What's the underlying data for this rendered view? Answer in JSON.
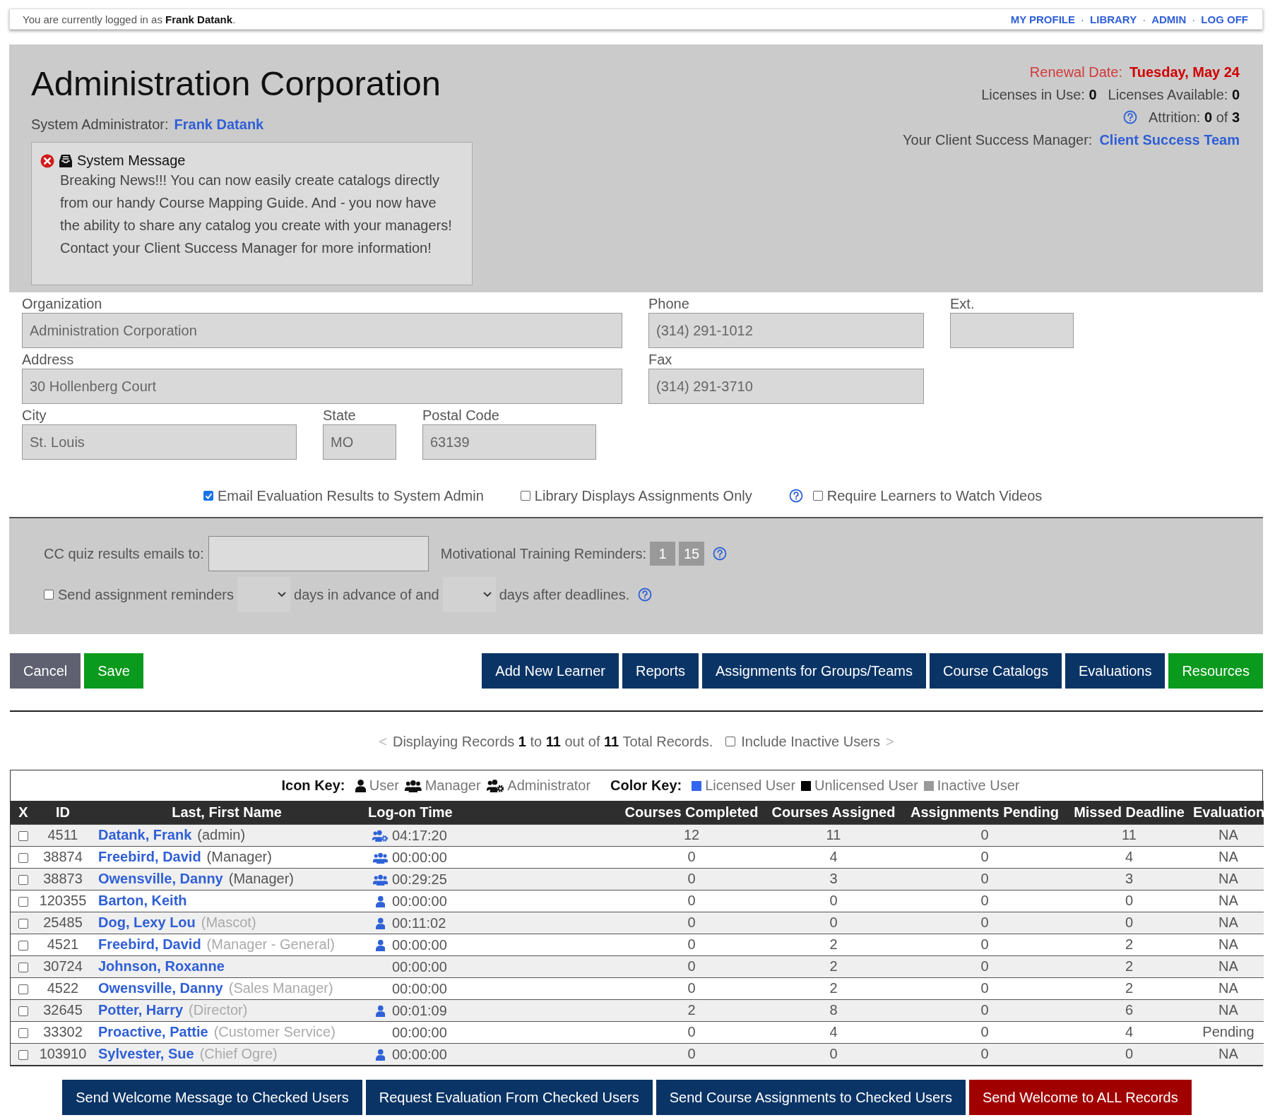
{
  "top_bar": {
    "login_text": "You are currently logged in as **Frank Datank**.",
    "separator": "·",
    "links": [
      "MY PROFILE",
      "LIBRARY",
      "ADMIN",
      "LOG OFF"
    ]
  },
  "header": {
    "title": "Administration Corporation",
    "admin_label": "System Administrator:",
    "admin_name": "Frank Datank",
    "message": {
      "title": "System Message",
      "body": "Breaking News!!! You can now easily create catalogs directly from our handy Course Mapping Guide. And - you now have the ability to share any catalog you create with your managers! Contact your Client Success Manager for more information!"
    },
    "renewal_label": "Renewal Date:",
    "renewal_date": "Tuesday, May 24",
    "licenses_in_use": "Licenses in Use: **0**",
    "licenses_available": "Licenses Available: **0**",
    "attrition": "Attrition: **0** of **3**",
    "csm_label": "Your Client Success Manager:",
    "csm_link": "Client Success Team"
  },
  "form": {
    "organization": {
      "label": "Organization",
      "value": "Administration Corporation"
    },
    "phone": {
      "label": "Phone",
      "value": "(314) 291-1012"
    },
    "ext": {
      "label": "Ext."
    },
    "address": {
      "label": "Address",
      "value": "30 Hollenberg Court"
    },
    "fax": {
      "label": "Fax",
      "value": "(314) 291-3710"
    },
    "city": {
      "label": "City",
      "value": "St. Louis"
    },
    "state": {
      "label": "State",
      "value": "MO"
    },
    "postal_code": {
      "label": "Postal Code",
      "value": "63139"
    }
  },
  "options": [
    {
      "label": "Email Evaluation Results to System Admin",
      "checked": true,
      "help": false
    },
    {
      "label": "Library Displays Assignments Only",
      "checked": false,
      "help": false
    },
    {
      "label": "Require Learners to Watch Videos",
      "checked": false,
      "help": true
    }
  ],
  "settings": {
    "cc_label": "CC quiz results emails to:",
    "reminders_label": "Motivational Training Reminders:",
    "reminder_values": [
      "1",
      "15"
    ],
    "send_reminders": {
      "label": "Send assignment reminders",
      "checked": false
    },
    "advance_label": "days in advance of and",
    "after_label": "days after deadlines."
  },
  "actions": {
    "left": [
      {
        "label": "Cancel",
        "kind": "neutral"
      },
      {
        "label": "Save",
        "kind": "success"
      }
    ],
    "right": [
      {
        "label": "Add New Learner",
        "kind": "primary"
      },
      {
        "label": "Reports",
        "kind": "primary"
      },
      {
        "label": "Assignments for Groups/Teams",
        "kind": "primary"
      },
      {
        "label": "Course Catalogs",
        "kind": "primary"
      },
      {
        "label": "Evaluations",
        "kind": "primary"
      },
      {
        "label": "Resources",
        "kind": "success"
      }
    ]
  },
  "summary": {
    "prev": "<",
    "text": "Displaying Records **1** to **11** out of **11** Total Records.",
    "include_inactive": {
      "label": "Include Inactive Users",
      "checked": false
    },
    "next": ">"
  },
  "icon_key": {
    "label": "Icon Key:",
    "items": [
      {
        "label": "User",
        "kind": "user"
      },
      {
        "label": "Manager",
        "kind": "manager"
      },
      {
        "label": "Administrator",
        "kind": "administrator"
      }
    ]
  },
  "color_key": {
    "label": "Color Key:",
    "items": [
      {
        "label": "Licensed User",
        "color": "#3366ee"
      },
      {
        "label": "Unlicensed User",
        "color": "#000000"
      },
      {
        "label": "Inactive User",
        "color": "#999999"
      }
    ]
  },
  "table": {
    "columns": [
      "X",
      "ID",
      "Last, First Name",
      "Log-on Time",
      "Courses Completed",
      "Courses Assigned",
      "Assignments Pending",
      "Missed Deadline",
      "Evaluation"
    ],
    "rows": [
      {
        "checked": false,
        "id": "4511",
        "name": "Datank, Frank",
        "role": "(admin)",
        "role_muted": false,
        "kind": "administrator",
        "logon": "04:17:20",
        "completed": "12",
        "assigned": "11",
        "pending": "0",
        "missed": "11",
        "evaluation": "NA"
      },
      {
        "checked": false,
        "id": "38874",
        "name": "Freebird, David",
        "role": "(Manager)",
        "role_muted": false,
        "kind": "manager",
        "logon": "00:00:00",
        "completed": "0",
        "assigned": "4",
        "pending": "0",
        "missed": "4",
        "evaluation": "NA"
      },
      {
        "checked": false,
        "id": "38873",
        "name": "Owensville, Danny",
        "role": "(Manager)",
        "role_muted": false,
        "kind": "manager",
        "logon": "00:29:25",
        "completed": "0",
        "assigned": "3",
        "pending": "0",
        "missed": "3",
        "evaluation": "NA"
      },
      {
        "checked": false,
        "id": "120355",
        "name": "Barton, Keith",
        "kind": "user",
        "logon": "00:00:00",
        "completed": "0",
        "assigned": "0",
        "pending": "0",
        "missed": "0",
        "evaluation": "NA"
      },
      {
        "checked": false,
        "id": "25485",
        "name": "Dog, Lexy Lou",
        "role": "(Mascot)",
        "role_muted": true,
        "kind": "user",
        "logon": "00:11:02",
        "completed": "0",
        "assigned": "0",
        "pending": "0",
        "missed": "0",
        "evaluation": "NA"
      },
      {
        "checked": false,
        "id": "4521",
        "name": "Freebird, David",
        "role": "(Manager - General)",
        "role_muted": true,
        "kind": "user",
        "logon": "00:00:00",
        "completed": "0",
        "assigned": "2",
        "pending": "0",
        "missed": "2",
        "evaluation": "NA"
      },
      {
        "checked": false,
        "id": "30724",
        "name": "Johnson, Roxanne",
        "kind": "none",
        "logon": "00:00:00",
        "completed": "0",
        "assigned": "2",
        "pending": "0",
        "missed": "2",
        "evaluation": "NA"
      },
      {
        "checked": false,
        "id": "4522",
        "name": "Owensville, Danny",
        "role": "(Sales Manager)",
        "role_muted": true,
        "kind": "none",
        "logon": "00:00:00",
        "completed": "0",
        "assigned": "2",
        "pending": "0",
        "missed": "2",
        "evaluation": "NA"
      },
      {
        "checked": false,
        "id": "32645",
        "name": "Potter, Harry",
        "role": "(Director)",
        "role_muted": true,
        "kind": "user",
        "logon": "00:01:09",
        "completed": "2",
        "assigned": "8",
        "pending": "0",
        "missed": "6",
        "evaluation": "NA"
      },
      {
        "checked": false,
        "id": "33302",
        "name": "Proactive, Pattie",
        "role": "(Customer Service)",
        "role_muted": true,
        "kind": "none",
        "logon": "00:00:00",
        "completed": "0",
        "assigned": "4",
        "pending": "0",
        "missed": "4",
        "evaluation": "Pending"
      },
      {
        "checked": false,
        "id": "103910",
        "name": "Sylvester, Sue",
        "role": "(Chief Ogre)",
        "role_muted": true,
        "kind": "user",
        "logon": "00:00:00",
        "completed": "0",
        "assigned": "0",
        "pending": "0",
        "missed": "0",
        "evaluation": "NA"
      }
    ]
  },
  "bulk_actions": [
    {
      "label": "Send Welcome Message to Checked Users",
      "kind": "primary"
    },
    {
      "label": "Request Evaluation From Checked Users",
      "kind": "primary"
    },
    {
      "label": "Send Course Assignments to Checked Users",
      "kind": "primary"
    },
    {
      "label": "Send Welcome to ALL Records",
      "kind": "danger"
    }
  ]
}
